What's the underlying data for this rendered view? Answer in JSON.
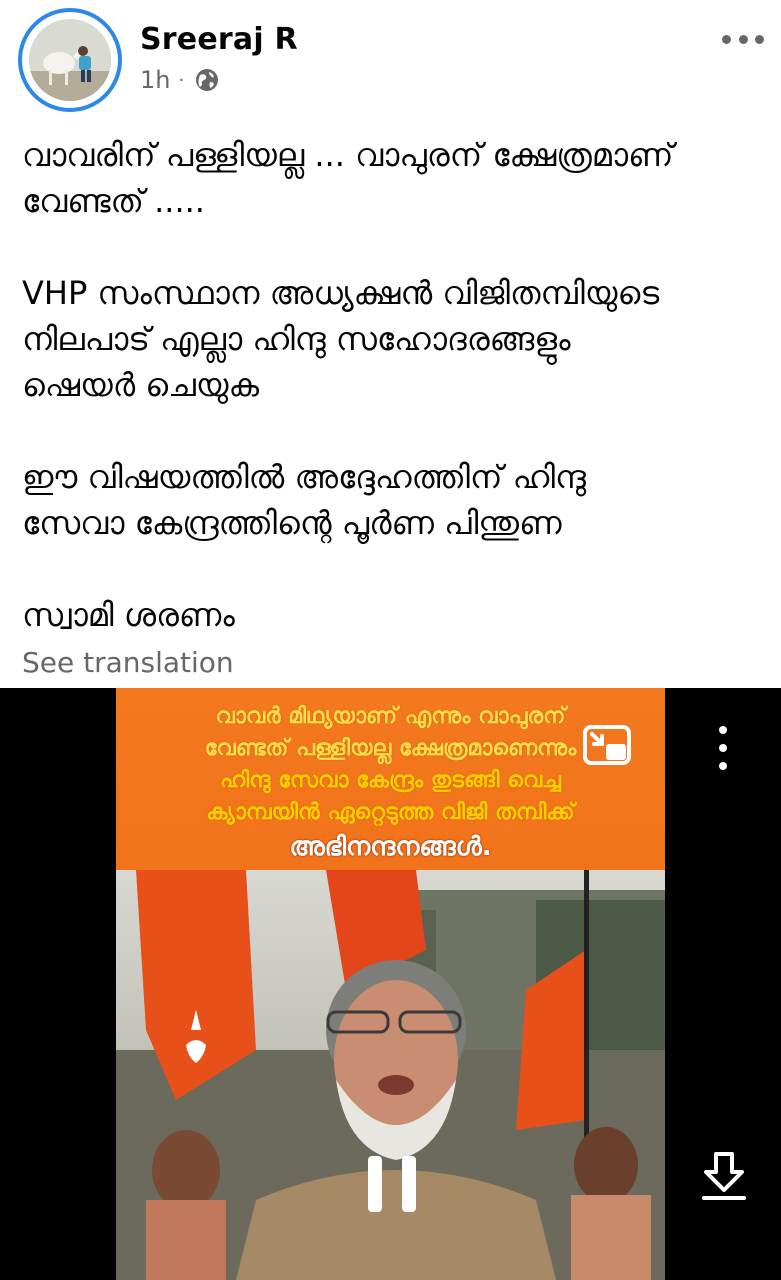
{
  "post": {
    "author": "Sreeraj R",
    "time": "1h",
    "separator": "·",
    "privacy_icon": "globe-icon",
    "more_icon": "more-horizontal-icon",
    "text_paragraphs": [
      [
        "വാവരിന് പള്ളിയല്ല ... വാപുരന് ക്ഷേത്രമാണ്",
        "വേണ്ടത് ....."
      ],
      [
        "VHP സംസ്ഥാന അധ്യക്ഷൻ വിജിതമ്പിയുടെ",
        "നിലപാട് എല്ലാ ഹിന്ദു സഹോദരങ്ങളും",
        "ഷെയർ ചെയുക"
      ],
      [
        "ഈ വിഷയത്തിൽ അദ്ദേഹത്തിന് ഹിന്ദു",
        "സേവാ കേന്ദ്രത്തിന്റെ പൂർണ പിന്തുണ"
      ],
      [
        "സ്വാമി ശരണം"
      ]
    ],
    "see_translation": "See translation"
  },
  "video": {
    "banner_lines": [
      "വാവർ മിഥ്യയാണ് എന്നും വാപുരന്",
      "വേണ്ടത് പള്ളിയല്ല ക്ഷേത്രമാണെന്നും",
      "ഹിന്ദു സേവാ കേന്ദ്രം തുടങ്ങി വെച്ച",
      "ക്യാമ്പയിൻ ഏറ്റെടുത്ത വിജി തമ്പിക്ക്",
      "അഭിനന്ദനങ്ങൾ."
    ],
    "icons": {
      "pip": "picture-in-picture-icon",
      "more": "more-vertical-icon",
      "pause": "pause-icon",
      "download": "download-icon"
    },
    "colors": {
      "banner": "#f3781e",
      "banner_text": "#ffd21c",
      "flag": "#e8501a"
    }
  }
}
